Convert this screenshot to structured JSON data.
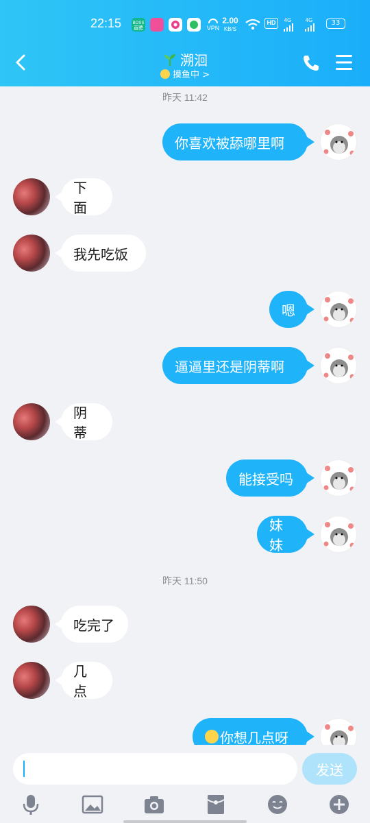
{
  "status_bar": {
    "time": "22:15",
    "boss_label_top": "BOSS",
    "boss_label_bottom": "直聘",
    "vpn_label": "VPN",
    "speed_value": "2.00",
    "speed_unit": "KB/S",
    "hd_label": "HD",
    "net1": "4G",
    "net2": "4G",
    "battery": "33"
  },
  "header": {
    "contact_name": "溯洄",
    "status_text": "摸鱼中",
    "status_arrow": ">"
  },
  "messages": {
    "ts1": "昨天 11:42",
    "m1": "你喜欢被舔哪里啊",
    "m2": "下面",
    "m3": "我先吃饭",
    "m4": "嗯",
    "m5": "逼逼里还是阴蒂啊",
    "m6": "阴蒂",
    "m7": "能接受吗",
    "m8": "妹妹",
    "ts2": "昨天 11:50",
    "m9": "吃完了",
    "m10": "几点",
    "m11": "你想几点呀"
  },
  "input": {
    "send_label": "发送"
  },
  "colors": {
    "header_start": "#2fc5f6",
    "header_end": "#1aaefa",
    "bubble_me": "#1fb3fa",
    "bubble_them": "#ffffff",
    "send_disabled": "#aee3fb"
  }
}
